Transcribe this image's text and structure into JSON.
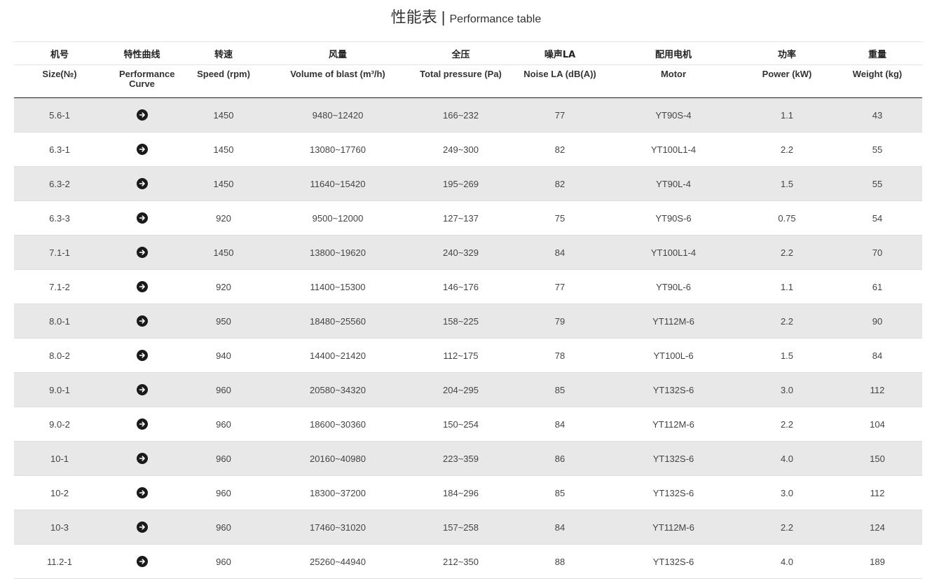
{
  "title": {
    "zh": "性能表",
    "separator": "|",
    "en": "Performance table"
  },
  "headers_zh": [
    "机号",
    "特性曲线",
    "转速",
    "风量",
    "全压",
    "噪声LA",
    "配用电机",
    "功率",
    "重量"
  ],
  "headers_en": [
    "Size(№)",
    "Performance Curve",
    "Speed (rpm)",
    "Volume of blast (m³/h)",
    "Total pressure (Pa)",
    "Noise LA (dB(A))",
    "Motor",
    "Power (kW)",
    "Weight (kg)"
  ],
  "curve_icon": "arrow-right-circle-icon",
  "rows": [
    {
      "size": "5.6-1",
      "speed": "1450",
      "volume": "9480~12420",
      "pressure": "166~232",
      "noise": "77",
      "motor": "YT90S-4",
      "power": "1.1",
      "weight": "43"
    },
    {
      "size": "6.3-1",
      "speed": "1450",
      "volume": "13080~17760",
      "pressure": "249~300",
      "noise": "82",
      "motor": "YT100L1-4",
      "power": "2.2",
      "weight": "55"
    },
    {
      "size": "6.3-2",
      "speed": "1450",
      "volume": "11640~15420",
      "pressure": "195~269",
      "noise": "82",
      "motor": "YT90L-4",
      "power": "1.5",
      "weight": "55"
    },
    {
      "size": "6.3-3",
      "speed": "920",
      "volume": "9500~12000",
      "pressure": "127~137",
      "noise": "75",
      "motor": "YT90S-6",
      "power": "0.75",
      "weight": "54"
    },
    {
      "size": "7.1-1",
      "speed": "1450",
      "volume": "13800~19620",
      "pressure": "240~329",
      "noise": "84",
      "motor": "YT100L1-4",
      "power": "2.2",
      "weight": "70"
    },
    {
      "size": "7.1-2",
      "speed": "920",
      "volume": "11400~15300",
      "pressure": "146~176",
      "noise": "77",
      "motor": "YT90L-6",
      "power": "1.1",
      "weight": "61"
    },
    {
      "size": "8.0-1",
      "speed": "950",
      "volume": "18480~25560",
      "pressure": "158~225",
      "noise": "79",
      "motor": "YT112M-6",
      "power": "2.2",
      "weight": "90"
    },
    {
      "size": "8.0-2",
      "speed": "940",
      "volume": "14400~21420",
      "pressure": "112~175",
      "noise": "78",
      "motor": "YT100L-6",
      "power": "1.5",
      "weight": "84"
    },
    {
      "size": "9.0-1",
      "speed": "960",
      "volume": "20580~34320",
      "pressure": "204~295",
      "noise": "85",
      "motor": "YT132S-6",
      "power": "3.0",
      "weight": "112"
    },
    {
      "size": "9.0-2",
      "speed": "960",
      "volume": "18600~30360",
      "pressure": "150~254",
      "noise": "84",
      "motor": "YT112M-6",
      "power": "2.2",
      "weight": "104"
    },
    {
      "size": "10-1",
      "speed": "960",
      "volume": "20160~40980",
      "pressure": "223~359",
      "noise": "86",
      "motor": "YT132S-6",
      "power": "4.0",
      "weight": "150"
    },
    {
      "size": "10-2",
      "speed": "960",
      "volume": "18300~37200",
      "pressure": "184~296",
      "noise": "85",
      "motor": "YT132S-6",
      "power": "3.0",
      "weight": "112"
    },
    {
      "size": "10-3",
      "speed": "960",
      "volume": "17460~31020",
      "pressure": "157~258",
      "noise": "84",
      "motor": "YT112M-6",
      "power": "2.2",
      "weight": "124"
    },
    {
      "size": "11.2-1",
      "speed": "960",
      "volume": "25260~44940",
      "pressure": "212~350",
      "noise": "88",
      "motor": "YT132S-6",
      "power": "4.0",
      "weight": "189"
    }
  ]
}
